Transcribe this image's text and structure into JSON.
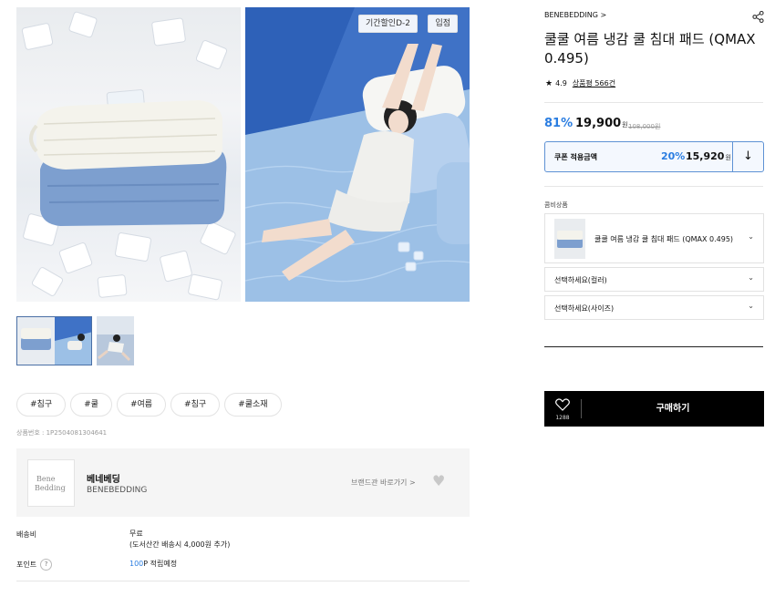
{
  "gallery": {
    "badges": {
      "event": "기간할인D-2",
      "status": "입점"
    }
  },
  "tags": [
    "#침구",
    "#쿨",
    "#여름",
    "#침구",
    "#쿨소재"
  ],
  "product_no": "상품번호 : 1P2504081304641",
  "brand_box": {
    "name": "베네베딩",
    "name_en": "BENEBEDDING",
    "link": "브랜드관 바로가기 >",
    "logo_line1": "Bene",
    "logo_line2": "Bedding"
  },
  "shipping": {
    "label": "배송비",
    "value": "무료",
    "note": "(도서산간 배송시 4,000원 추가)"
  },
  "points": {
    "label": "포인트",
    "help": "?",
    "amount": "100",
    "suffix": "P 적립예정"
  },
  "product": {
    "brand": "BENEBEDDING >",
    "title": "쿨쿨 여름 냉감 쿨 침대 패드 (QMAX 0.495)",
    "rating_star": "★",
    "rating": "4.9",
    "reviews": "상품평 566건",
    "discount": "81%",
    "price": "19,900",
    "currency": "원",
    "original_price": "108,000원"
  },
  "coupon": {
    "label": "쿠폰 적용금액",
    "percent": "20%",
    "price": "15,920",
    "currency": "원",
    "download_icon": "↓"
  },
  "options": {
    "combo_label": "콤비상품",
    "combo_product": "쿨쿨 여름 냉감 쿨 침대 패드 (QMAX 0.495)",
    "color": "선택하세요(컬러)",
    "size": "선택하세요(사이즈)",
    "chevron": "⌄"
  },
  "purchase": {
    "wish_count": "1288",
    "buy_label": "구매하기"
  },
  "colors": {
    "accent": "#2a7de1",
    "buy_bg": "#000000",
    "coupon_border": "#5e92d4"
  },
  "icons": [
    "share-icon",
    "heart-icon",
    "download-icon",
    "chevron-down-icon",
    "star-icon",
    "help-icon"
  ]
}
